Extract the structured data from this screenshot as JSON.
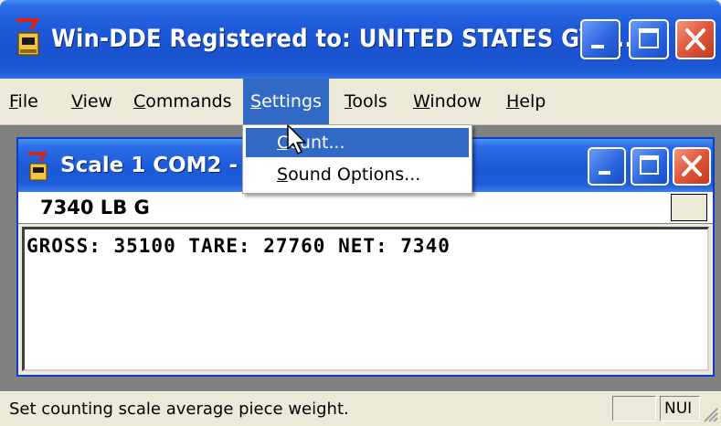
{
  "window": {
    "title": "Win-DDE  Registered to: UNITED STATES GYP...",
    "controls": [
      "minimize",
      "maximize",
      "close"
    ]
  },
  "menubar": {
    "items": [
      {
        "label": "File",
        "accel": "F",
        "rest": "ile"
      },
      {
        "label": "View",
        "accel": "V",
        "rest": "iew"
      },
      {
        "label": "Commands",
        "accel": "C",
        "rest": "ommands"
      },
      {
        "label": "Settings",
        "accel": "S",
        "rest": "ettings"
      },
      {
        "label": "Tools",
        "accel": "T",
        "rest": "ools"
      },
      {
        "label": "Window",
        "accel": "W",
        "rest": "indow"
      },
      {
        "label": "Help",
        "accel": "H",
        "rest": "elp"
      }
    ],
    "active": "Settings"
  },
  "settings_menu": {
    "items": [
      {
        "label": "Count...",
        "accel": "C",
        "rest": "ount...",
        "highlighted": true
      },
      {
        "label": "Sound Options...",
        "accel": "S",
        "rest": "ound Options...",
        "highlighted": false
      }
    ]
  },
  "child_window": {
    "title": "Scale 1  COM2 -",
    "weight_display": "7340 LB G",
    "data_line": "GROSS: 35100 TARE: 27760 NET: 7340"
  },
  "statusbar": {
    "message": "Set counting scale average piece weight.",
    "indicator": "NUI"
  },
  "colors": {
    "title_blue": "#1c58d8",
    "menu_highlight": "#316ac5",
    "close_red": "#e0553a",
    "chrome": "#ece9d8"
  },
  "icons": [
    "app-icon",
    "minimize-icon",
    "maximize-icon",
    "close-icon",
    "child-app-icon",
    "mouse-pointer-icon",
    "size-grip-icon"
  ]
}
